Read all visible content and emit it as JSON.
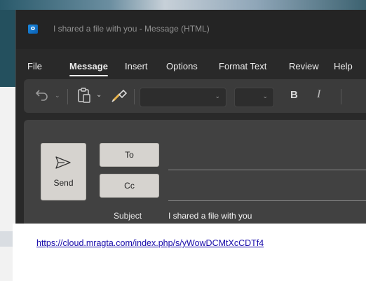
{
  "window": {
    "title": "I shared a file with you  -  Message (HTML)",
    "app_icon_letter": "o"
  },
  "menu": {
    "items": [
      "File",
      "Message",
      "Insert",
      "Options",
      "Format Text",
      "Review",
      "Help"
    ],
    "active": "Message"
  },
  "ribbon": {
    "undo_icon": "undo-icon",
    "paste_icon": "clipboard-paste-icon",
    "format_painter_icon": "format-painter-icon",
    "font_name_value": "",
    "font_size_value": "",
    "bold_label": "B",
    "italic_label": "I"
  },
  "compose": {
    "send_label": "Send",
    "to_label": "To",
    "cc_label": "Cc",
    "to_value": "",
    "cc_value": "",
    "subject_label": "Subject",
    "subject_value": "I shared a file with you"
  },
  "body": {
    "link_text": "https://cloud.mragta.com/index.php/s/yWowDCMtXcCDTf4"
  },
  "colors": {
    "window_bg": "#292929",
    "ribbon_bg": "#3b3b3b",
    "compose_bg": "#414141",
    "button_bg": "#d6d3cf",
    "link": "#1a0dab"
  }
}
